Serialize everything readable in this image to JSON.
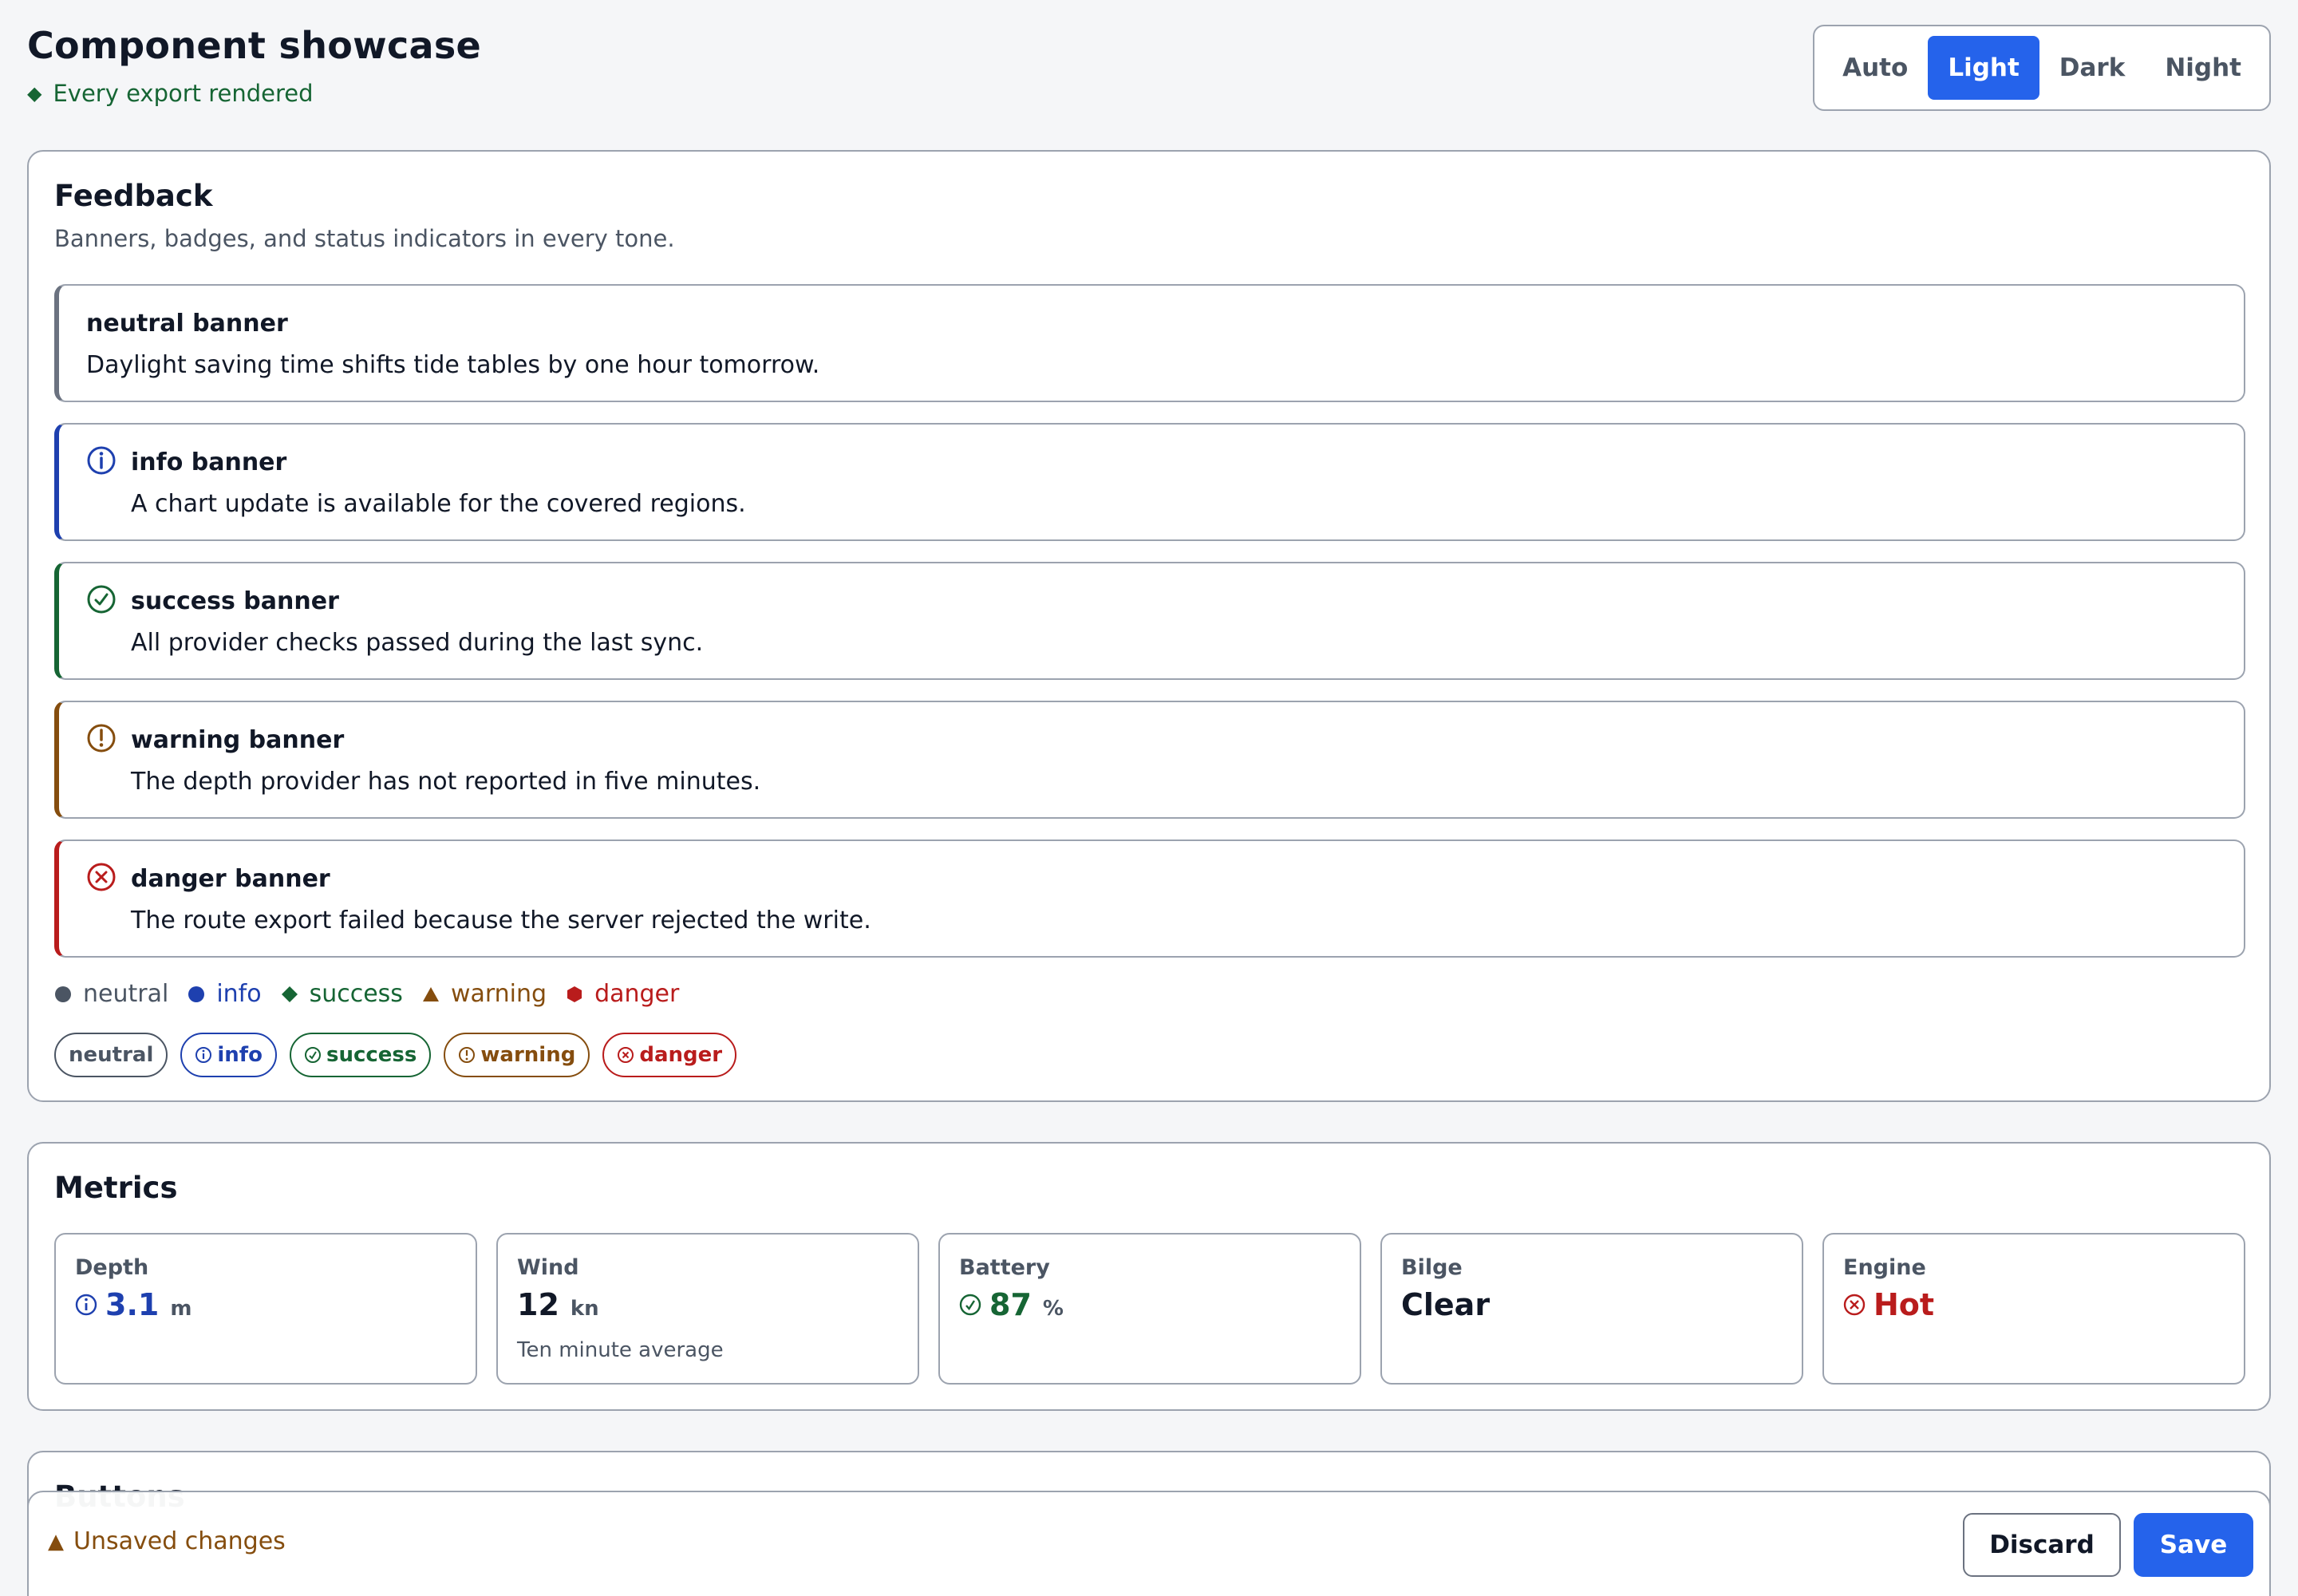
{
  "header": {
    "title": "Component showcase",
    "status": "Every export rendered",
    "themes": [
      "Auto",
      "Light",
      "Dark",
      "Night"
    ],
    "active_theme": "Light"
  },
  "feedback": {
    "title": "Feedback",
    "subtitle": "Banners, badges, and status indicators in every tone.",
    "banners": [
      {
        "tone": "neutral",
        "title": "neutral banner",
        "text": "Daylight saving time shifts tide tables by one hour tomorrow."
      },
      {
        "tone": "info",
        "title": "info banner",
        "text": "A chart update is available for the covered regions."
      },
      {
        "tone": "success",
        "title": "success banner",
        "text": "All provider checks passed during the last sync."
      },
      {
        "tone": "warning",
        "title": "warning banner",
        "text": "The depth provider has not reported in five minutes."
      },
      {
        "tone": "danger",
        "title": "danger banner",
        "text": "The route export failed because the server rejected the write."
      }
    ],
    "legend": [
      "neutral",
      "info",
      "success",
      "warning",
      "danger"
    ],
    "badges": [
      "neutral",
      "info",
      "success",
      "warning",
      "danger"
    ]
  },
  "metrics": {
    "title": "Metrics",
    "items": [
      {
        "label": "Depth",
        "value": "3.1",
        "unit": "m",
        "note": "",
        "tone": "info"
      },
      {
        "label": "Wind",
        "value": "12",
        "unit": "kn",
        "note": "Ten minute average",
        "tone": "neutral"
      },
      {
        "label": "Battery",
        "value": "87",
        "unit": "%",
        "note": "",
        "tone": "success"
      },
      {
        "label": "Bilge",
        "value": "Clear",
        "unit": "",
        "note": "",
        "tone": "neutral"
      },
      {
        "label": "Engine",
        "value": "Hot",
        "unit": "",
        "note": "",
        "tone": "danger"
      }
    ]
  },
  "buttons_section": {
    "title": "Buttons"
  },
  "save_bar": {
    "message": "Unsaved changes",
    "discard_label": "Discard",
    "save_label": "Save"
  },
  "colors": {
    "accent": "#2563eb",
    "neutral": "#6b7280",
    "info": "#1e40af",
    "success": "#166534",
    "warning": "#854d0e",
    "danger": "#b91c1c",
    "border": "#9ca3af",
    "background": "#f5f6f8"
  }
}
